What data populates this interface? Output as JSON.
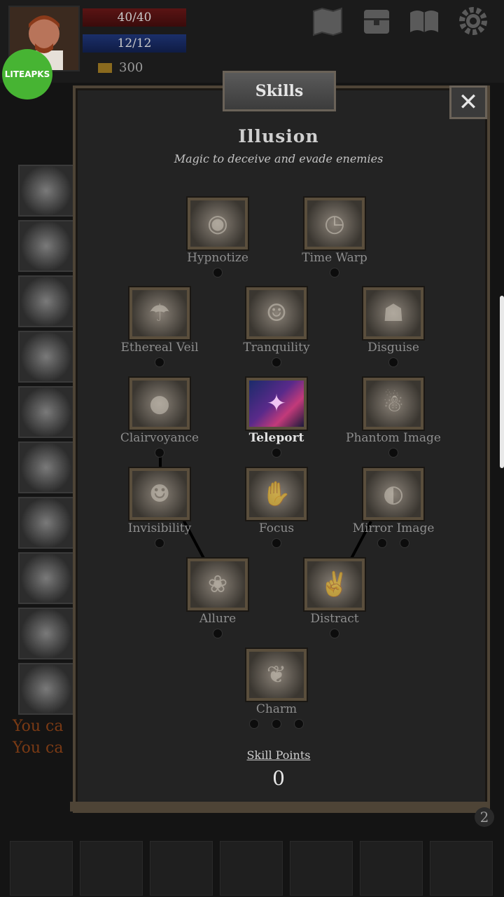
{
  "hud": {
    "hp": "40/40",
    "mp": "12/12",
    "gold": "300",
    "watermark": "LITEAPKS",
    "icons": [
      "map-icon",
      "chest-icon",
      "book-icon",
      "gear-icon"
    ]
  },
  "log": {
    "line1": "You ca",
    "line2": "You ca"
  },
  "panel": {
    "tab": "Skills",
    "close": "✕",
    "title": "Illusion",
    "subtitle": "Magic to deceive and evade enemies",
    "skill_points_label": "Skill Points",
    "skill_points_value": "0"
  },
  "skills": [
    {
      "name": "Hypnotize",
      "icon": "eye-spiral-icon",
      "learned": false
    },
    {
      "name": "Time Warp",
      "icon": "clock-icon",
      "learned": false
    },
    {
      "name": "Ethereal Veil",
      "icon": "veil-icon",
      "learned": false
    },
    {
      "name": "Tranquility",
      "icon": "calm-face-icon",
      "learned": false
    },
    {
      "name": "Disguise",
      "icon": "mask-icon",
      "learned": false
    },
    {
      "name": "Clairvoyance",
      "icon": "crystal-ball-icon",
      "learned": false
    },
    {
      "name": "Teleport",
      "icon": "teleport-icon",
      "learned": true
    },
    {
      "name": "Phantom Image",
      "icon": "ghost-icon",
      "learned": false
    },
    {
      "name": "Invisibility",
      "icon": "fading-face-icon",
      "learned": false
    },
    {
      "name": "Focus",
      "icon": "hand-focus-icon",
      "learned": false
    },
    {
      "name": "Mirror Image",
      "icon": "mirror-icon",
      "learned": false
    },
    {
      "name": "Allure",
      "icon": "allure-icon",
      "learned": false
    },
    {
      "name": "Distract",
      "icon": "hands-icon",
      "learned": false
    },
    {
      "name": "Charm",
      "icon": "charm-hand-icon",
      "learned": false
    }
  ],
  "colors": {
    "panel_border": "#4e4436",
    "label_text": "#8e8e8e",
    "active_label": "#e2e2e2",
    "hp_bar": "#5a1414",
    "mp_bar": "#1b2f6a",
    "watermark_bg": "#47b433"
  }
}
